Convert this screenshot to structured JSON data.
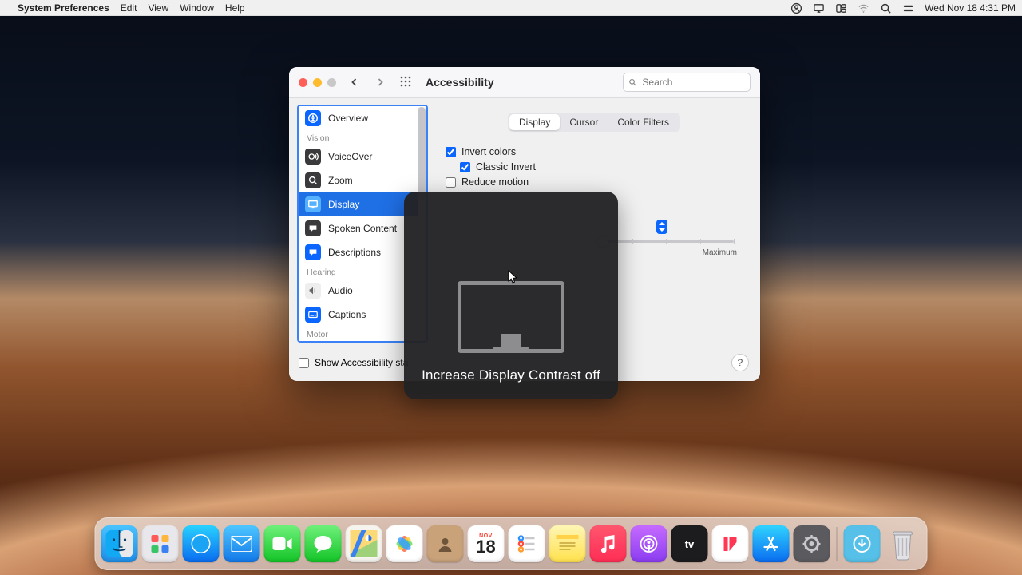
{
  "menubar": {
    "app_name": "System Preferences",
    "menus": [
      "Edit",
      "View",
      "Window",
      "Help"
    ],
    "clock": "Wed Nov 18  4:31 PM"
  },
  "window": {
    "title": "Accessibility",
    "search_placeholder": "Search"
  },
  "sidebar": {
    "items": [
      {
        "label": "Overview",
        "group": null
      },
      {
        "label": "VoiceOver",
        "group": "Vision"
      },
      {
        "label": "Zoom",
        "group": null
      },
      {
        "label": "Display",
        "group": null,
        "selected": true
      },
      {
        "label": "Spoken Content",
        "group": null
      },
      {
        "label": "Descriptions",
        "group": null
      },
      {
        "label": "Audio",
        "group": "Hearing"
      },
      {
        "label": "Captions",
        "group": null
      },
      {
        "label": "",
        "group": "Motor"
      }
    ],
    "group_vision": "Vision",
    "group_hearing": "Hearing",
    "group_motor": "Motor"
  },
  "tabs": {
    "display": "Display",
    "cursor": "Cursor",
    "color_filters": "Color Filters",
    "active": "display"
  },
  "checks": {
    "invert_colors": {
      "label": "Invert colors",
      "checked": true
    },
    "classic_invert": {
      "label": "Classic Invert",
      "checked": true
    },
    "reduce_motion": {
      "label": "Reduce motion",
      "checked": false
    }
  },
  "slider": {
    "max_label": "Maximum"
  },
  "footer": {
    "show_status": "Show Accessibility sta"
  },
  "hud": {
    "text": "Increase Display Contrast off"
  },
  "dock": {
    "apps": [
      "Finder",
      "Launchpad",
      "Safari",
      "Mail",
      "FaceTime",
      "Messages",
      "Maps",
      "Photos",
      "Contacts",
      "Calendar",
      "Reminders",
      "Notes",
      "Music",
      "Podcasts",
      "TV",
      "News",
      "App Store",
      "System Preferences"
    ],
    "folder": "Downloads",
    "trash": "Trash",
    "cal_day": "18",
    "cal_mon": "NOV"
  }
}
